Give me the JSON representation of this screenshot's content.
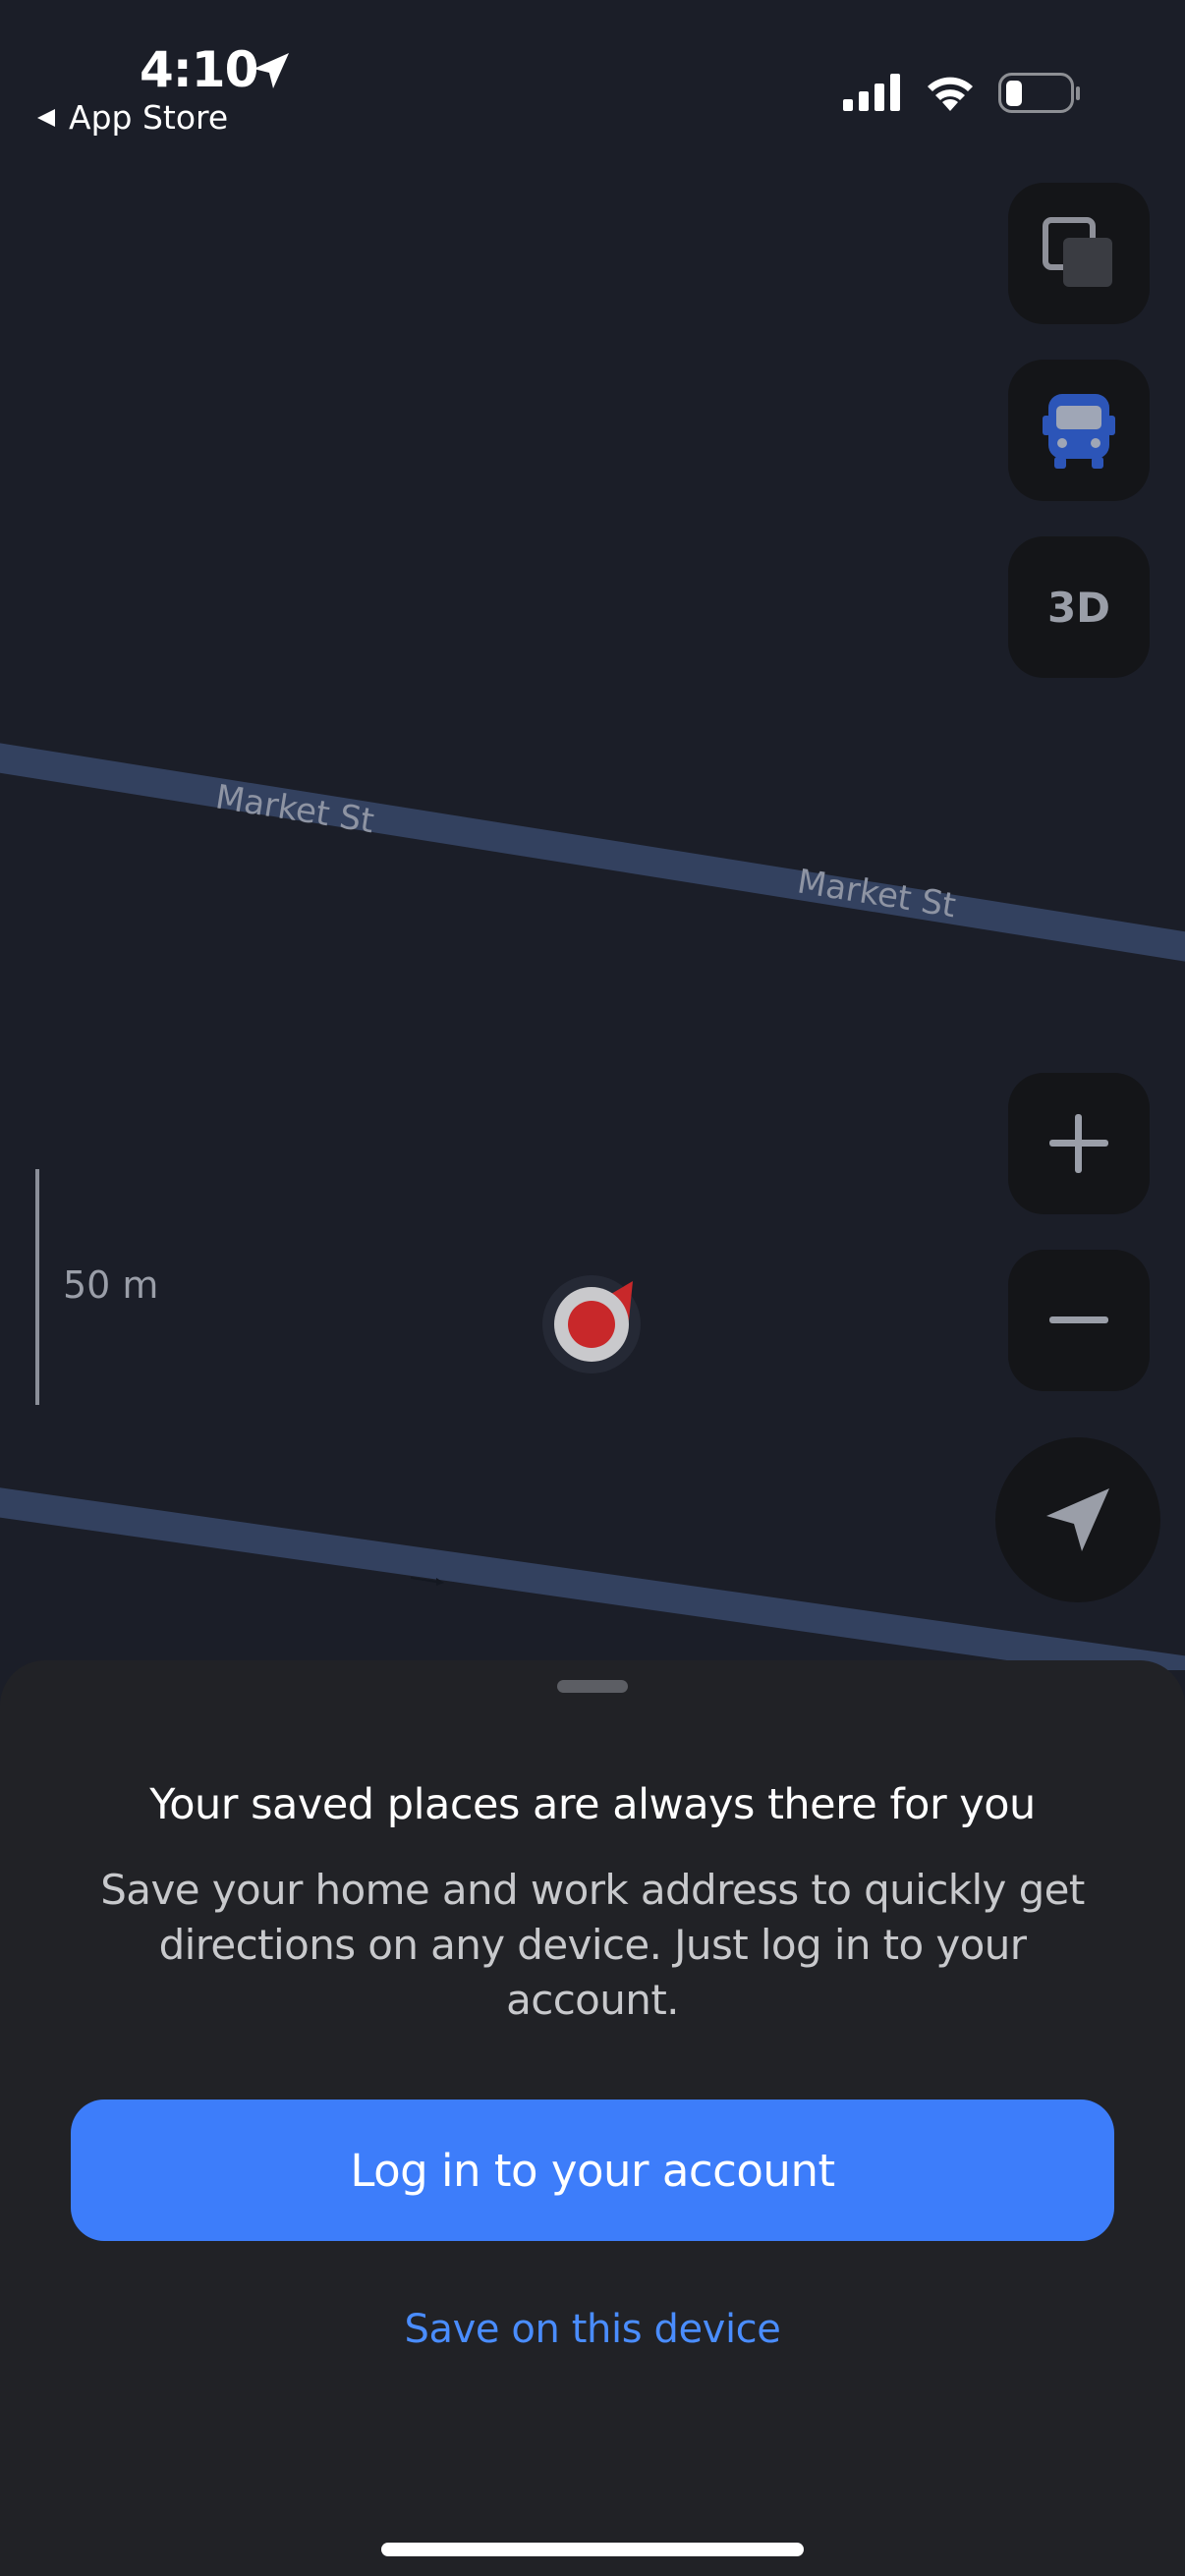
{
  "status_bar": {
    "time": "4:10",
    "back_label": "App Store"
  },
  "map": {
    "streets": [
      "Market St",
      "Market St"
    ],
    "scale_label": "50 m",
    "controls": {
      "three_d_label": "3D"
    }
  },
  "sheet": {
    "title": "Your saved places are always there for you",
    "description": "Save your home and work address to quickly get directions on any device. Just log in to your account.",
    "primary_button": "Log in to your account",
    "secondary_link": "Save on this device"
  },
  "colors": {
    "accent": "#3d7dfa",
    "link": "#4a8dff",
    "map_background": "#1b1e28",
    "road": "#3a4a6e",
    "sheet_background": "#212226",
    "marker": "#c8282a"
  }
}
